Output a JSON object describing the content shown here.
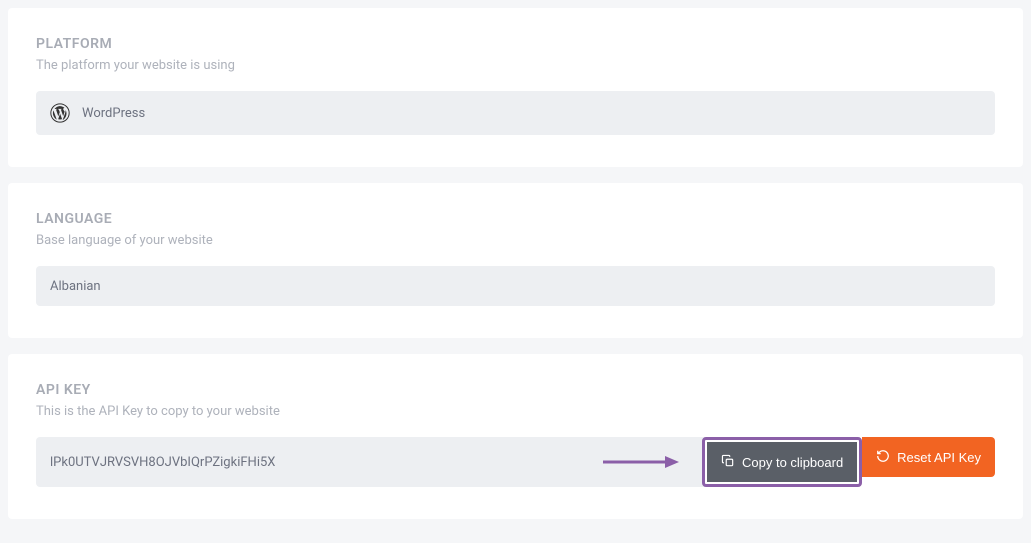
{
  "platform": {
    "title": "PLATFORM",
    "subtitle": "The platform your website is using",
    "value": "WordPress",
    "icon": "wordpress-icon"
  },
  "language": {
    "title": "LANGUAGE",
    "subtitle": "Base language of your website",
    "value": "Albanian"
  },
  "apikey": {
    "title": "API KEY",
    "subtitle": "This is the API Key to copy to your website",
    "value": "lPk0UTVJRVSVH8OJVbIQrPZigkiFHi5X",
    "copy_label": "Copy to clipboard",
    "reset_label": "Reset API Key"
  },
  "colors": {
    "accent": "#f26422",
    "highlight": "#8b5fa8",
    "muted_bg": "#edeff2",
    "btn_dark": "#5a5f67"
  }
}
